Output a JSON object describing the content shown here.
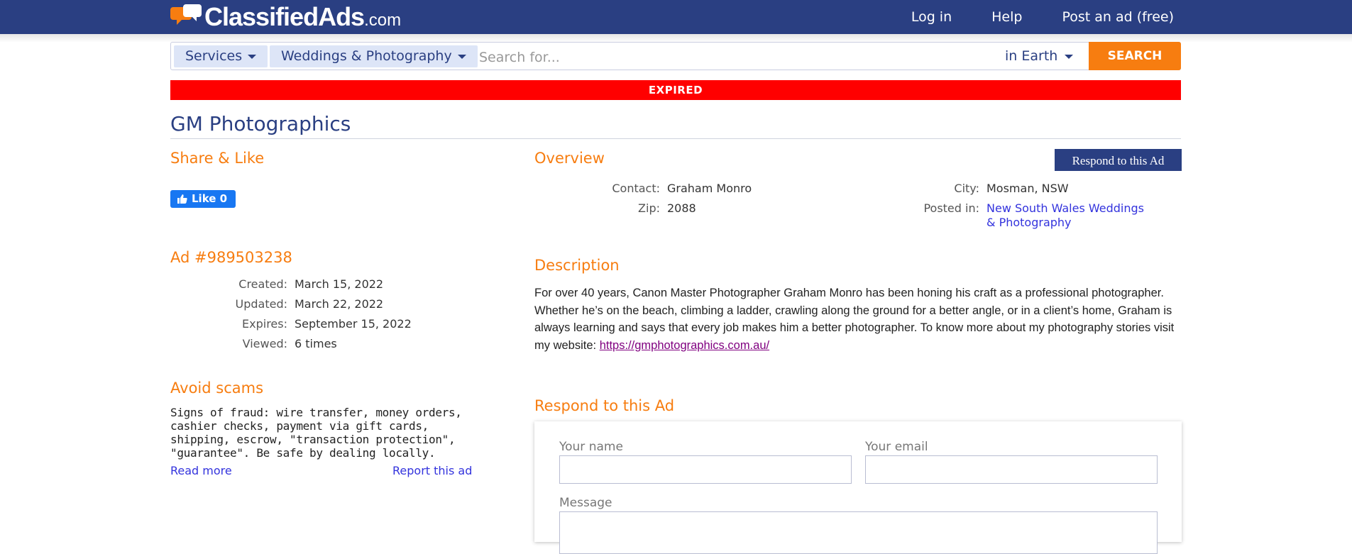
{
  "header": {
    "logo_main": "ClassifiedAds",
    "logo_suffix": ".com",
    "links": [
      "Log in",
      "Help",
      "Post an ad (free)"
    ]
  },
  "search": {
    "category": "Services",
    "subcategory": "Weddings & Photography",
    "placeholder": "Search for...",
    "location": "in Earth",
    "button": "SEARCH"
  },
  "status_banner": "EXPIRED",
  "ad": {
    "title": "GM Photographics",
    "share_heading": "Share & Like",
    "like_label": "Like 0",
    "id_heading": "Ad #989503238",
    "meta": [
      {
        "label": "Created:",
        "value": "March 15, 2022"
      },
      {
        "label": "Updated:",
        "value": "March 22, 2022"
      },
      {
        "label": "Expires:",
        "value": "September 15, 2022"
      },
      {
        "label": "Viewed:",
        "value": "6 times"
      }
    ],
    "scams_heading": "Avoid scams",
    "scams_text": "Signs of fraud: wire transfer, money orders, cashier checks, payment via gift cards, shipping, escrow, \"transaction protection\", \"guarantee\". Be safe by dealing locally.",
    "read_more": "Read more",
    "report": "Report this ad"
  },
  "overview": {
    "heading": "Overview",
    "respond_button": "Respond to this Ad",
    "contact_label": "Contact:",
    "contact_value": "Graham Monro",
    "zip_label": "Zip:",
    "zip_value": "2088",
    "city_label": "City:",
    "city_value": "Mosman, NSW",
    "posted_label": "Posted in:",
    "posted_value_line1": "New South Wales Weddings",
    "posted_value_line2": "& Photography"
  },
  "description": {
    "heading": "Description",
    "text": "For over 40 years, Canon Master Photographer Graham Monro has been honing his craft as a professional photographer. Whether he’s on the beach, climbing a ladder, crawling along the ground for a better angle, or in a client’s home, Graham is always learning and says that every job makes him a better photographer. To know more about my photography stories visit my website: ",
    "link": "https://gmphotographics.com.au/"
  },
  "respond_form": {
    "heading": "Respond to this Ad",
    "name_label": "Your name",
    "email_label": "Your email",
    "message_label": "Message"
  },
  "colors": {
    "brand": "#2a3f82",
    "accent": "#f77d10",
    "expired": "#ff0000"
  }
}
